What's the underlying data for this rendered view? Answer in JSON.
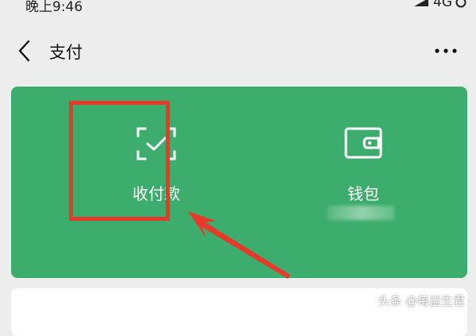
{
  "status_bar": {
    "time": "晚上9:46",
    "network": "4G"
  },
  "nav": {
    "title": "支付"
  },
  "pay_card": {
    "collect_pay_label": "收付款",
    "wallet_label": "钱包"
  },
  "watermark": "头条 @每益生君",
  "colors": {
    "card_green": "#3cad6c",
    "highlight_red": "#e8392b",
    "background": "#ededed"
  },
  "icons": {
    "back": "chevron-left-icon",
    "more": "more-dots-icon",
    "collect_pay": "scan-check-icon",
    "wallet": "wallet-icon"
  }
}
